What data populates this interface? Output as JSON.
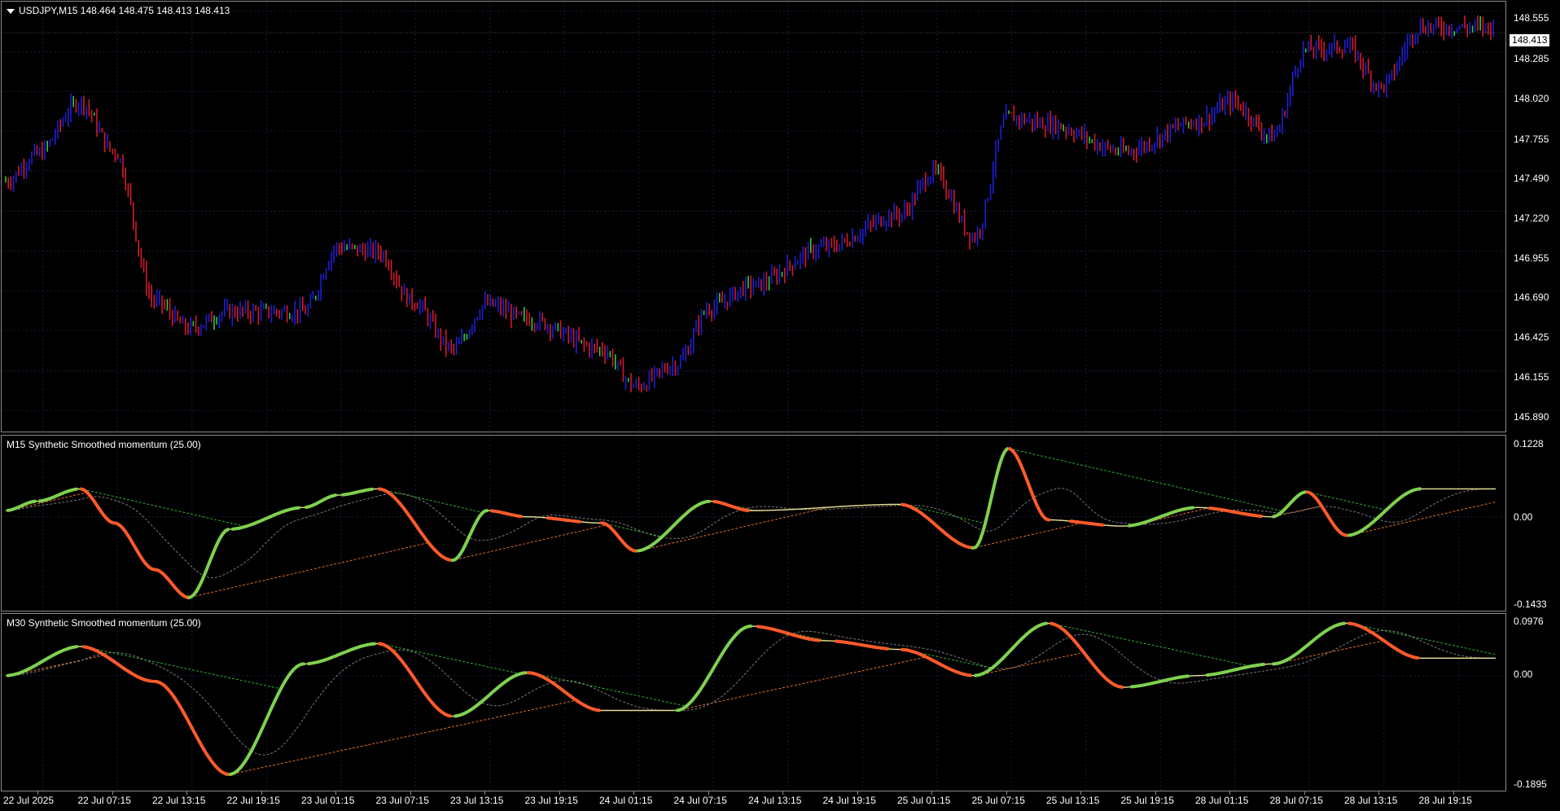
{
  "main_chart": {
    "title": "USDJPY,M15  148.464 148.475 148.413 148.413",
    "current_price": "148.413",
    "price_range": [
      145.75,
      148.62
    ],
    "y_labels": [
      "148.555",
      "148.285",
      "148.020",
      "147.755",
      "147.490",
      "147.220",
      "146.955",
      "146.690",
      "146.425",
      "146.155",
      "145.890"
    ],
    "colors": {
      "bull": "#1f1fd6",
      "bear": "#d21a2a",
      "doji": "#2ecc40",
      "grid": "#14143a"
    }
  },
  "indicator_m15": {
    "title": "M15 Synthetic Smoothed momentum (25.00)",
    "y_labels": [
      "0.1228",
      "0.00",
      "-0.1433"
    ],
    "range": [
      -0.1433,
      0.1228
    ]
  },
  "indicator_m30": {
    "title": "M30 Synthetic Smoothed momentum (25.00)",
    "y_labels": [
      "0.0976",
      "0.00",
      "-0.1895"
    ],
    "range": [
      -0.1895,
      0.0976
    ]
  },
  "x_axis": {
    "labels": [
      "22 Jul 2025",
      "22 Jul 07:15",
      "22 Jul 13:15",
      "22 Jul 19:15",
      "23 Jul 01:15",
      "23 Jul 07:15",
      "23 Jul 13:15",
      "23 Jul 19:15",
      "24 Jul 01:15",
      "24 Jul 07:15",
      "24 Jul 13:15",
      "24 Jul 19:15",
      "25 Jul 01:15",
      "25 Jul 07:15",
      "25 Jul 13:15",
      "25 Jul 19:15",
      "28 Jul 01:15",
      "28 Jul 07:15",
      "28 Jul 13:15",
      "28 Jul 19:15"
    ]
  },
  "chart_data": {
    "type": "candlestick",
    "symbol": "USDJPY",
    "timeframe": "M15",
    "ohlc_last": {
      "open": 148.464,
      "high": 148.475,
      "low": 148.413,
      "close": 148.413
    },
    "close_path": [
      [
        "22 Jul 2025",
        147.42
      ],
      [
        "22 Jul 03:00",
        147.6
      ],
      [
        "22 Jul 07:15",
        147.95
      ],
      [
        "22 Jul 10:00",
        147.62
      ],
      [
        "22 Jul 13:15",
        146.62
      ],
      [
        "22 Jul 16:00",
        146.44
      ],
      [
        "22 Jul 19:15",
        146.55
      ],
      [
        "23 Jul 01:15",
        146.55
      ],
      [
        "23 Jul 04:00",
        146.98
      ],
      [
        "23 Jul 07:15",
        146.95
      ],
      [
        "23 Jul 10:00",
        146.62
      ],
      [
        "23 Jul 13:15",
        146.3
      ],
      [
        "23 Jul 16:00",
        146.6
      ],
      [
        "23 Jul 19:15",
        146.5
      ],
      [
        "24 Jul 01:15",
        146.3
      ],
      [
        "24 Jul 04:00",
        146.05
      ],
      [
        "24 Jul 07:15",
        146.2
      ],
      [
        "24 Jul 10:00",
        146.58
      ],
      [
        "24 Jul 13:15",
        146.72
      ],
      [
        "24 Jul 19:15",
        146.98
      ],
      [
        "25 Jul 01:15",
        147.2
      ],
      [
        "25 Jul 04:00",
        147.48
      ],
      [
        "25 Jul 07:15",
        147.05
      ],
      [
        "25 Jul 10:00",
        147.85
      ],
      [
        "25 Jul 13:15",
        147.8
      ],
      [
        "25 Jul 19:15",
        147.62
      ],
      [
        "28 Jul 01:15",
        147.82
      ],
      [
        "28 Jul 04:00",
        147.95
      ],
      [
        "28 Jul 07:15",
        147.72
      ],
      [
        "28 Jul 10:00",
        148.3
      ],
      [
        "28 Jul 13:15",
        148.32
      ],
      [
        "28 Jul 16:00",
        148.05
      ],
      [
        "28 Jul 19:15",
        148.45
      ]
    ],
    "momentum_m15": [
      [
        "22 Jul 2025",
        0.01
      ],
      [
        "22 Jul 03:00",
        0.025
      ],
      [
        "22 Jul 07:15",
        0.045
      ],
      [
        "22 Jul 10:00",
        -0.01
      ],
      [
        "22 Jul 13:15",
        -0.085
      ],
      [
        "22 Jul 16:00",
        -0.13
      ],
      [
        "22 Jul 19:15",
        -0.02
      ],
      [
        "23 Jul 01:15",
        0.015
      ],
      [
        "23 Jul 04:00",
        0.035
      ],
      [
        "23 Jul 07:15",
        0.045
      ],
      [
        "23 Jul 13:15",
        -0.07
      ],
      [
        "23 Jul 16:00",
        0.01
      ],
      [
        "23 Jul 19:15",
        0.0
      ],
      [
        "24 Jul 01:15",
        -0.01
      ],
      [
        "24 Jul 04:00",
        -0.055
      ],
      [
        "24 Jul 10:00",
        0.025
      ],
      [
        "24 Jul 13:15",
        0.01
      ],
      [
        "25 Jul 01:15",
        0.02
      ],
      [
        "25 Jul 07:15",
        -0.05
      ],
      [
        "25 Jul 10:00",
        0.11
      ],
      [
        "25 Jul 13:15",
        -0.005
      ],
      [
        "25 Jul 19:15",
        -0.015
      ],
      [
        "28 Jul 01:15",
        0.015
      ],
      [
        "28 Jul 07:15",
        0.0
      ],
      [
        "28 Jul 10:00",
        0.04
      ],
      [
        "28 Jul 13:15",
        -0.03
      ],
      [
        "28 Jul 19:15",
        0.045
      ]
    ],
    "momentum_m30": [
      [
        "22 Jul 2025",
        0.0
      ],
      [
        "22 Jul 07:15",
        0.05
      ],
      [
        "22 Jul 13:15",
        -0.01
      ],
      [
        "22 Jul 19:15",
        -0.17
      ],
      [
        "23 Jul 01:15",
        0.02
      ],
      [
        "23 Jul 07:15",
        0.055
      ],
      [
        "23 Jul 13:15",
        -0.07
      ],
      [
        "23 Jul 19:15",
        0.005
      ],
      [
        "24 Jul 01:15",
        -0.06
      ],
      [
        "24 Jul 07:15",
        -0.06
      ],
      [
        "24 Jul 13:15",
        0.085
      ],
      [
        "24 Jul 19:15",
        0.06
      ],
      [
        "25 Jul 01:15",
        0.045
      ],
      [
        "25 Jul 07:15",
        0.0
      ],
      [
        "25 Jul 13:15",
        0.09
      ],
      [
        "25 Jul 19:15",
        -0.02
      ],
      [
        "28 Jul 01:15",
        0.0
      ],
      [
        "28 Jul 07:15",
        0.02
      ],
      [
        "28 Jul 13:15",
        0.09
      ],
      [
        "28 Jul 19:15",
        0.03
      ]
    ]
  }
}
